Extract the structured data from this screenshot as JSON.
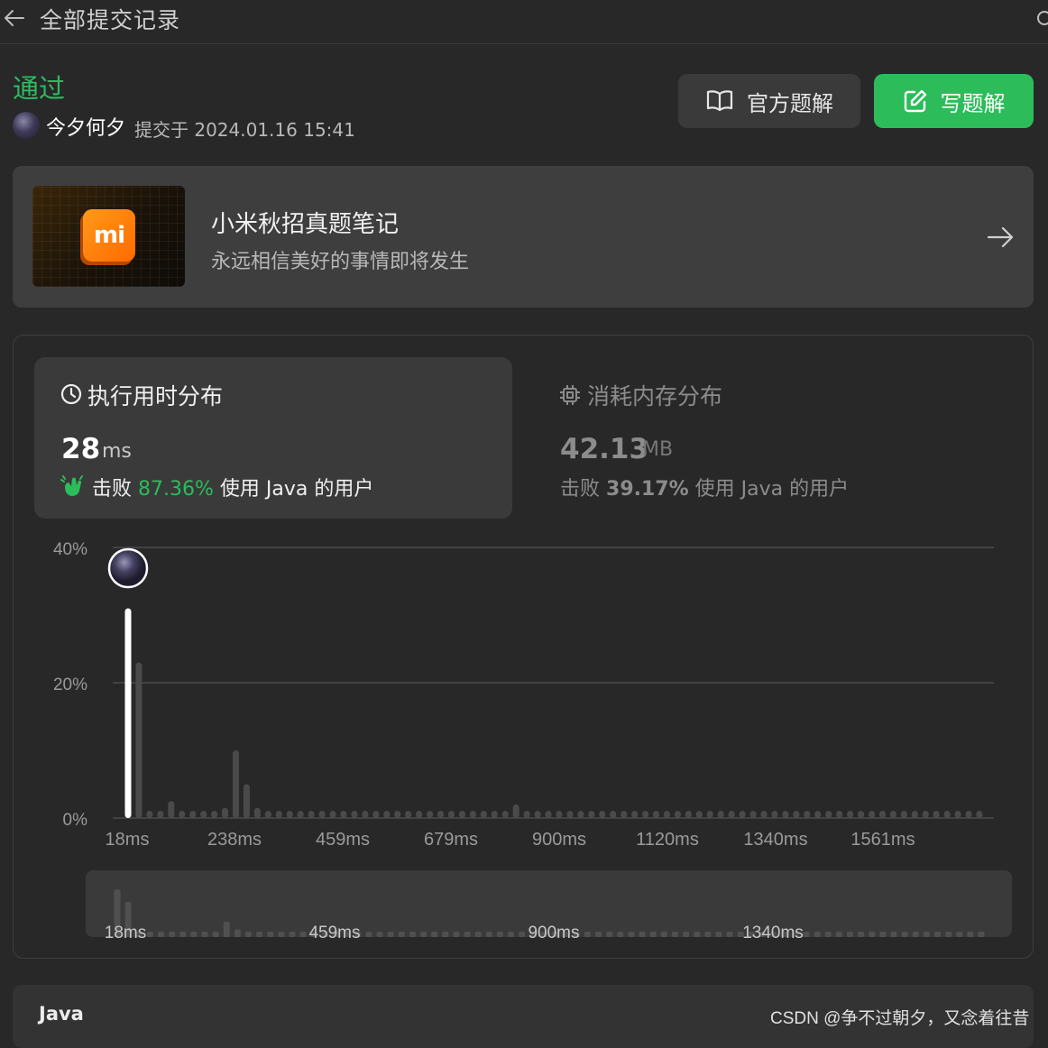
{
  "header": {
    "title": "全部提交记录"
  },
  "submission": {
    "status": "通过",
    "username": "今夕何夕",
    "submitted_text": "提交于 2024.01.16 15:41"
  },
  "actions": {
    "official_solution": "官方题解",
    "write_solution": "写题解"
  },
  "banner": {
    "logo_text": "mi",
    "title": "小米秋招真题笔记",
    "subtitle": "永远相信美好的事情即将发生"
  },
  "runtime": {
    "title": "执行用时分布",
    "value": "28",
    "unit": "ms",
    "beat_prefix": "击败",
    "beat_percent": "87.36%",
    "beat_suffix": "使用 Java 的用户"
  },
  "memory": {
    "title": "消耗内存分布",
    "value": "42.13",
    "unit": "MB",
    "beat_prefix": "击败",
    "beat_percent": "39.17%",
    "beat_suffix": "使用 Java 的用户"
  },
  "chart_data": {
    "type": "bar",
    "y_ticks": [
      "0%",
      "20%",
      "40%"
    ],
    "ylim": [
      0,
      40
    ],
    "x_tick_labels": [
      "18ms",
      "238ms",
      "459ms",
      "679ms",
      "900ms",
      "1120ms",
      "1340ms",
      "1561ms"
    ],
    "mini_tick_labels": [
      "18ms",
      "459ms",
      "900ms",
      "1340ms"
    ],
    "highlight": {
      "x": "28ms",
      "value": 31
    },
    "values": [
      31,
      23,
      1,
      1,
      2.5,
      1,
      1,
      1,
      1,
      1.5,
      10,
      5,
      1.5,
      1,
      1,
      1,
      1,
      1,
      1,
      1,
      1,
      1,
      1,
      1,
      1,
      1,
      1,
      1,
      1,
      1,
      1,
      1,
      1,
      1,
      1,
      1,
      2,
      1,
      1,
      1,
      1,
      1,
      1,
      1,
      1,
      1,
      1,
      1,
      1,
      1,
      1,
      1,
      1,
      1,
      1,
      1,
      1,
      1,
      1,
      1,
      1,
      1,
      1,
      1,
      1,
      1,
      1,
      1,
      1,
      1,
      1,
      1,
      1,
      1,
      1,
      1,
      1,
      1,
      1,
      1
    ],
    "colors": {
      "highlight": "#ffffff",
      "bar": "#4a4a4a",
      "grid": "#4a4a4a"
    }
  },
  "code": {
    "language": "Java"
  },
  "watermark": "CSDN @争不过朝夕，又念着往昔"
}
